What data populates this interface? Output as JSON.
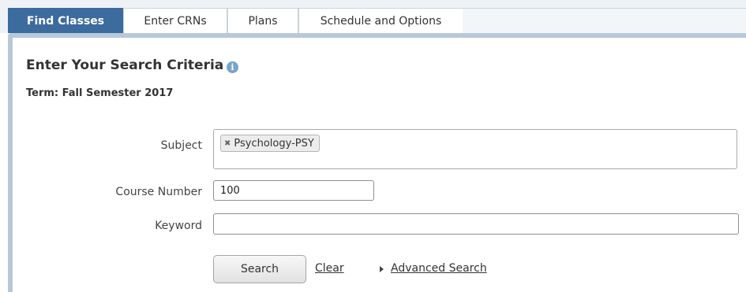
{
  "tabs": [
    {
      "label": "Find Classes",
      "active": true
    },
    {
      "label": "Enter CRNs",
      "active": false
    },
    {
      "label": "Plans",
      "active": false
    },
    {
      "label": "Schedule and Options",
      "active": false
    }
  ],
  "search": {
    "heading": "Enter Your Search Criteria",
    "info_icon": "info-icon",
    "term": "Term: Fall Semester 2017",
    "subject_label": "Subject",
    "subject_selected": [
      "Psychology-PSY"
    ],
    "course_number_label": "Course Number",
    "course_number_value": "100",
    "keyword_label": "Keyword",
    "keyword_value": "",
    "search_button": "Search",
    "clear_link": "Clear",
    "advanced_link": "Advanced Search"
  },
  "colors": {
    "active_tab": "#3c6b9e",
    "panel_border": "#b7c8da",
    "info_icon": "#79a4c9"
  }
}
